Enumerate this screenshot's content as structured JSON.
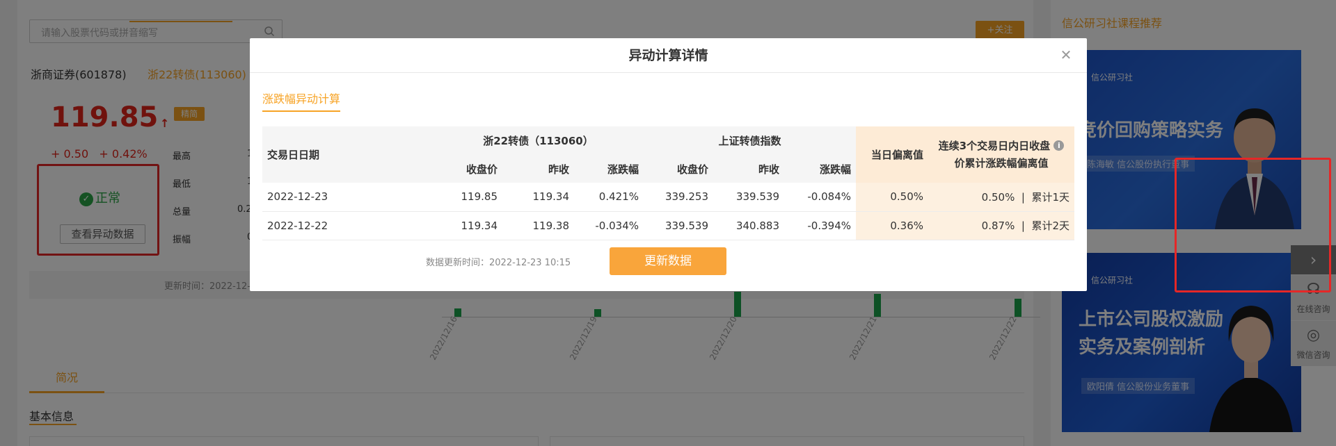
{
  "search": {
    "placeholder": "请输入股票代码或拼音缩写"
  },
  "follow_label": "+关注",
  "tabs": [
    {
      "label": "浙商证券(601878)"
    },
    {
      "label": "浙22转债(113060)"
    }
  ],
  "quote": {
    "price": "119.85",
    "change": "+ 0.50",
    "change_pct": "+ 0.42%",
    "tag": "精简",
    "stats": [
      {
        "label": "最高",
        "value": "1"
      },
      {
        "label": "最低",
        "value": "1"
      },
      {
        "label": "总量",
        "value": "0.2"
      },
      {
        "label": "振幅",
        "value": "0"
      }
    ]
  },
  "status": {
    "label": "正常",
    "view_button": "查看异动数据"
  },
  "update_time_label": "更新时间：2022-12-",
  "chart_dates": [
    "2022/12/16",
    "2022/12/19",
    "2022/12/20",
    "2022/12/21",
    "2022/12/22"
  ],
  "section": {
    "tab": "简况",
    "basic_info": "基本信息"
  },
  "sidebar": {
    "title": "信公研习社课程推荐",
    "banners": [
      {
        "logo": "信公研习社",
        "title": "竞价回购策略实务",
        "subtitle": "陈海敏 信公股份执行董事"
      },
      {
        "logo": "信公研习社",
        "title_line1": "上市公司股权激励",
        "title_line2": "实务及案例剖析",
        "subtitle": "欧阳倩 信公股份业务董事"
      }
    ]
  },
  "side_tools": {
    "online": "在线咨询",
    "wechat": "微信咨询"
  },
  "modal": {
    "title": "异动计算详情",
    "tab": "涨跌幅异动计算",
    "headers": {
      "date": "交易日日期",
      "bond_group": "浙22转债（113060）",
      "index_group": "上证转债指数",
      "close": "收盘价",
      "prev_close": "昨收",
      "pct": "涨跌幅",
      "daily_dev": "当日偏离值",
      "cum_dev_line1": "连续3个交易日内日收盘",
      "cum_dev_line2": "价累计涨跌幅偏离值"
    },
    "rows": [
      {
        "date": "2022-12-23",
        "bond_close": "119.85",
        "bond_prev": "119.34",
        "bond_pct": "0.421%",
        "idx_close": "339.253",
        "idx_prev": "339.539",
        "idx_pct": "-0.084%",
        "daily_dev": "0.50%",
        "cum_dev": "0.50%  |  累计1天"
      },
      {
        "date": "2022-12-22",
        "bond_close": "119.34",
        "bond_prev": "119.38",
        "bond_pct": "-0.034%",
        "idx_close": "339.539",
        "idx_prev": "340.883",
        "idx_pct": "-0.394%",
        "daily_dev": "0.36%",
        "cum_dev": "0.87%  |  累计2天"
      }
    ],
    "update_time": "数据更新时间：2022-12-23 10:15",
    "refresh_button": "更新数据"
  },
  "colors": {
    "accent": "#f7a325",
    "price_red": "#e1251b",
    "status_green": "#2aa546",
    "highlight_bg": "#fdf0e0",
    "annotation_red": "#e52727"
  }
}
